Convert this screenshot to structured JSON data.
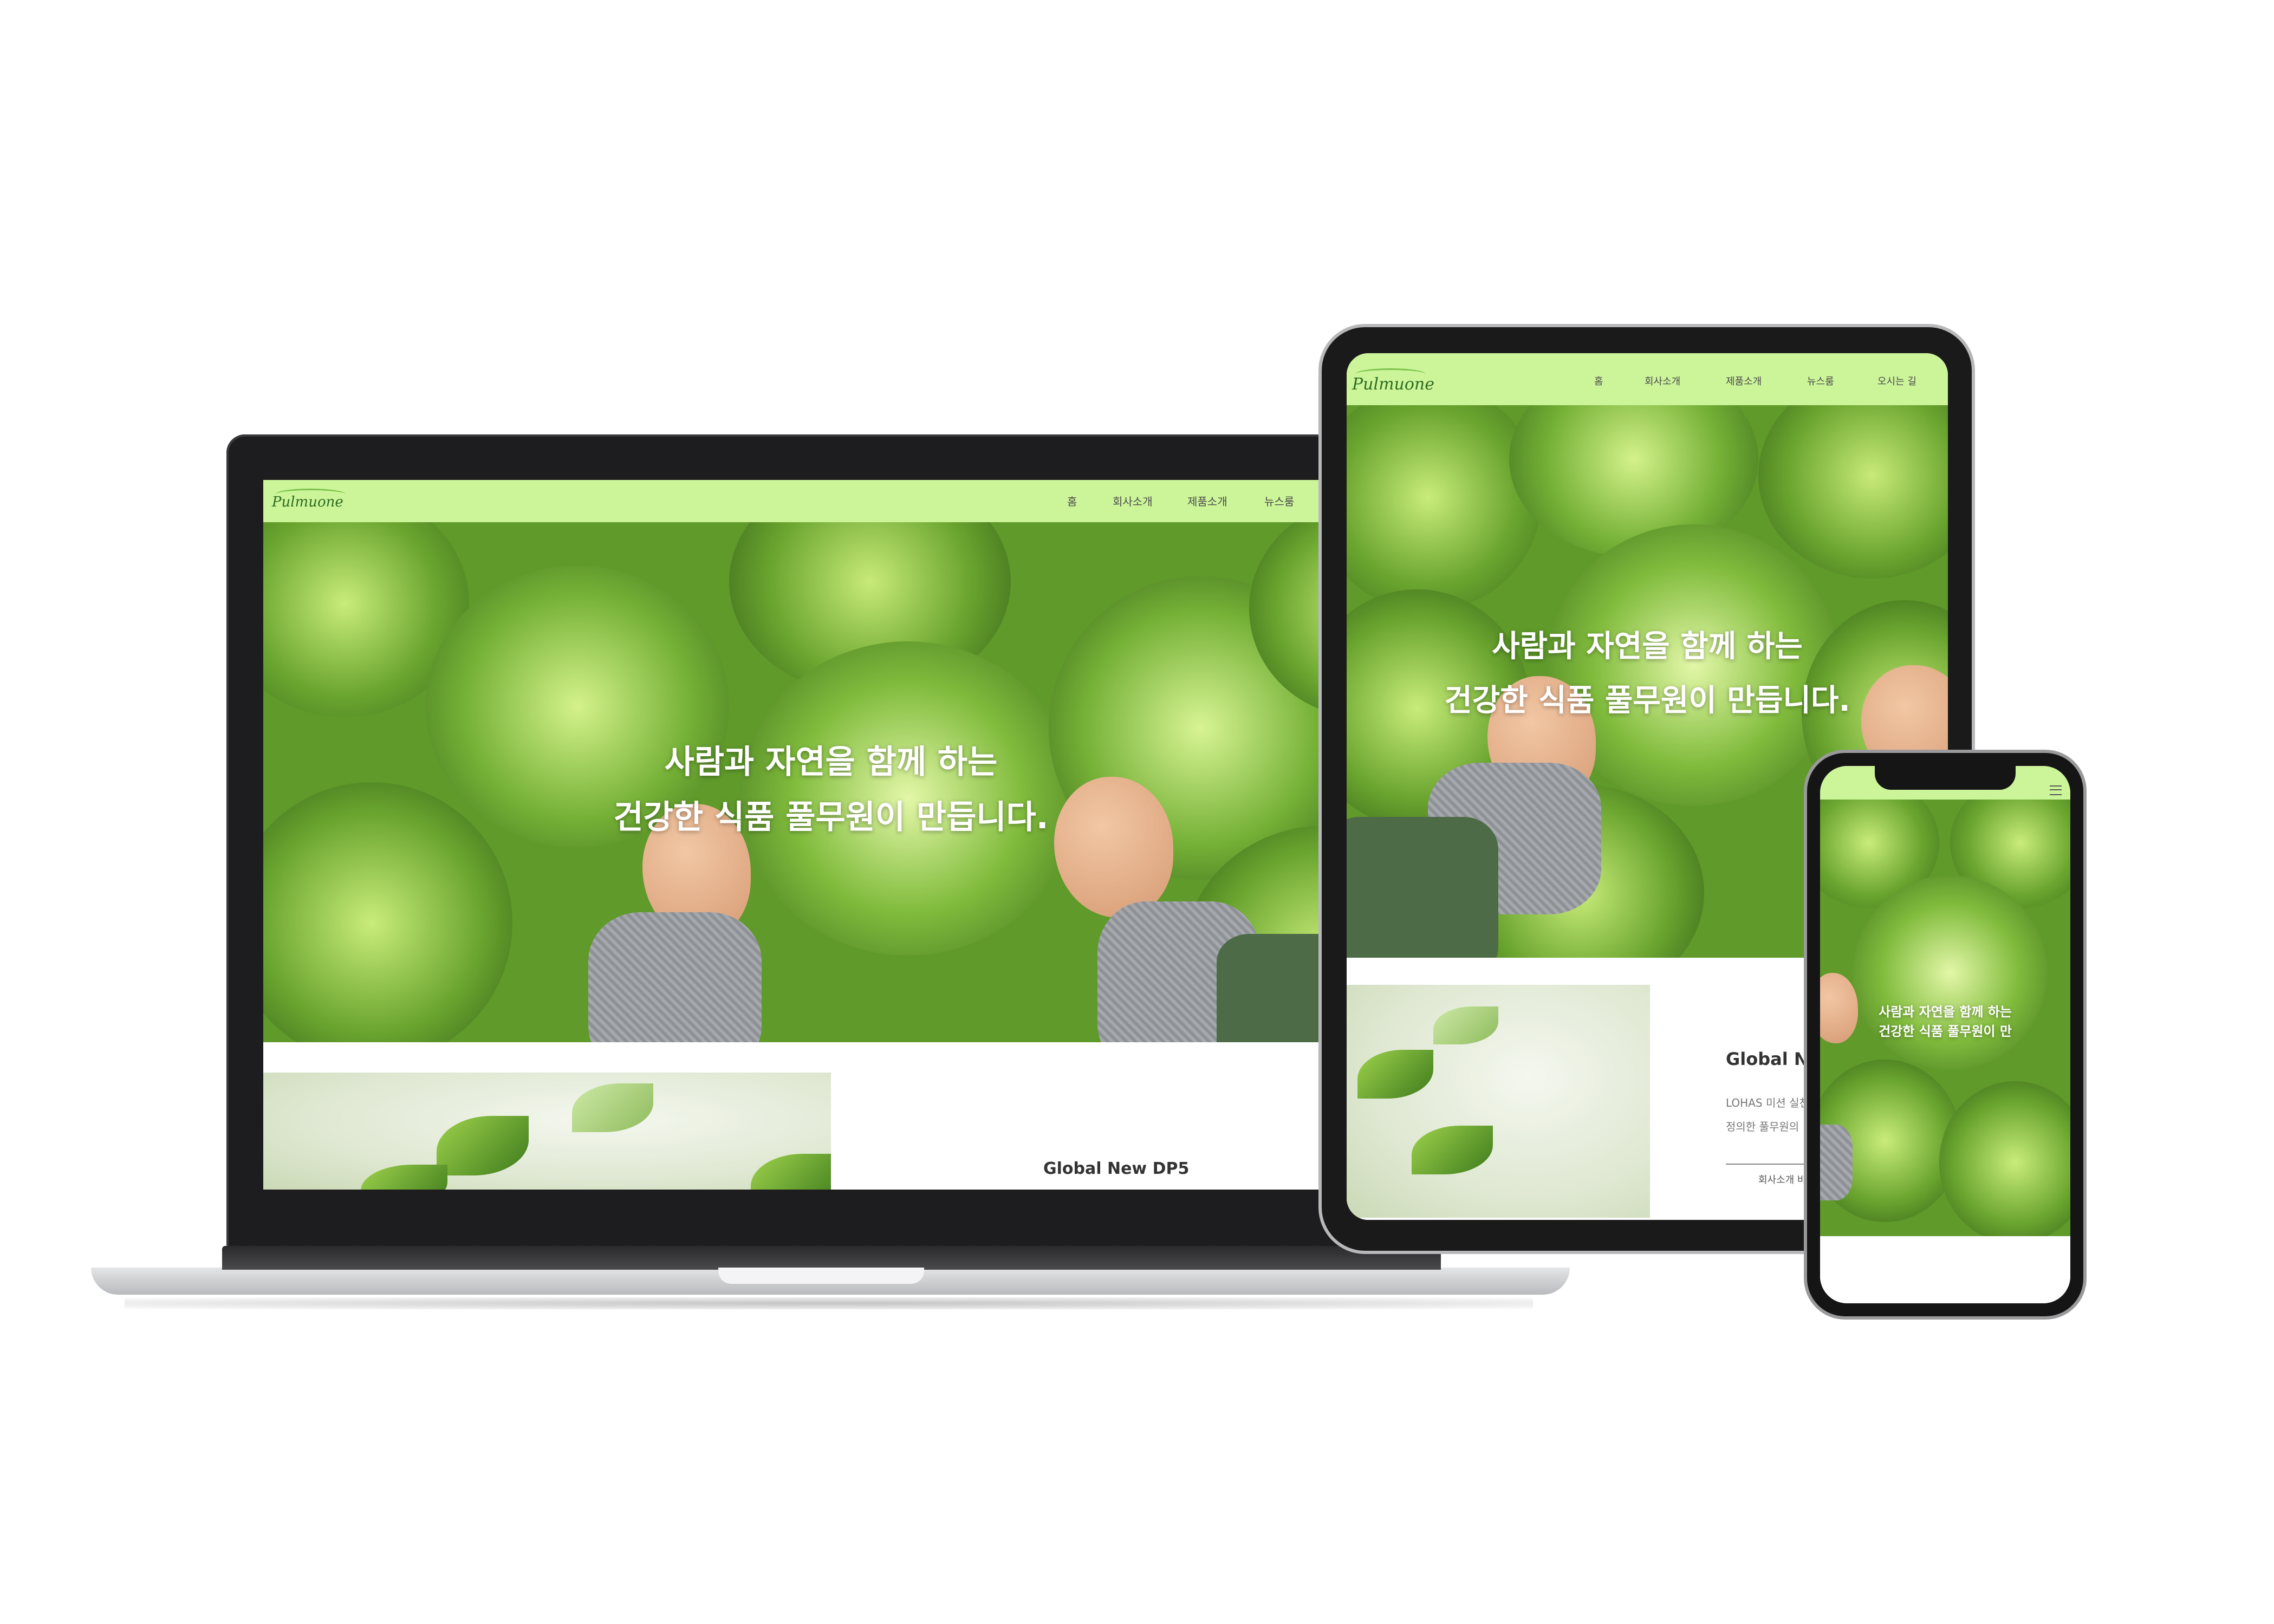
{
  "site": {
    "logo": "Pulmuone",
    "nav": [
      "홈",
      "회사소개",
      "제품소개",
      "뉴스룸",
      "오시는 길"
    ],
    "hero_line1": "사람과 자연을 함께 하는",
    "hero_line2": "건강한 식품 풀무원이 만듭니다.",
    "section_title": "Global New DP5",
    "tablet_section_title": "Global Ne",
    "tablet_text1": "LOHAS 미션 실천",
    "tablet_text2": "정의한 풀무원의",
    "tablet_button": "회사소개 바"
  },
  "phone": {
    "hero_line1": "사람과 자연을 함께 하는",
    "hero_line2": "건강한 식품 풀무원이 만"
  },
  "colors": {
    "nav_bg": "#ccf59a",
    "hero_green": "#6aa52f",
    "device_frame": "#1f1f1f",
    "laptop_body": "#c9cacc"
  }
}
